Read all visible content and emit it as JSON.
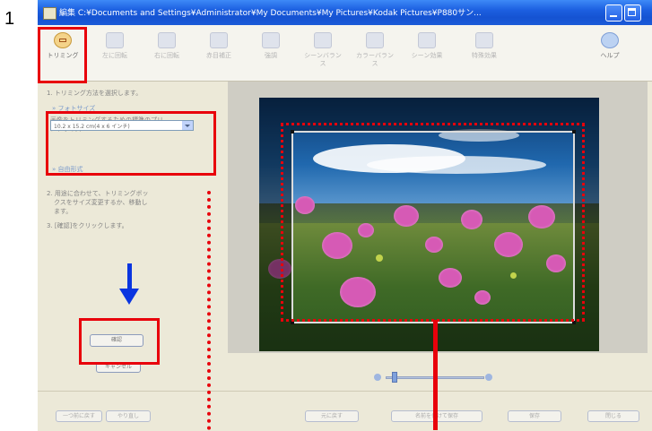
{
  "step_number": "1",
  "window": {
    "title": "編集 C:¥Documents and Settings¥Administrator¥My Documents¥My Pictures¥Kodak Pictures¥P880サン..."
  },
  "toolbar": {
    "items": [
      {
        "label": "トリミング",
        "icon": "trim-icon"
      },
      {
        "label": "左に回転",
        "icon": "rotate-left-icon"
      },
      {
        "label": "右に回転",
        "icon": "rotate-right-icon"
      },
      {
        "label": "赤目補正",
        "icon": "red-eye-icon"
      },
      {
        "label": "強調",
        "icon": "enhance-icon"
      },
      {
        "label": "シーンバランス",
        "icon": "scene-balance-icon"
      },
      {
        "label": "カラーバランス",
        "icon": "color-balance-icon"
      },
      {
        "label": "シーン効果",
        "icon": "scene-effect-icon"
      },
      {
        "label": "特殊効果",
        "icon": "special-effect-icon"
      },
      {
        "label": "ヘルプ",
        "icon": "help-icon"
      }
    ]
  },
  "left_panel": {
    "step1": "1. トリミング方法を選択します。",
    "photo_size_link": "» フォトサイズ",
    "size_desc_line1": "画像をトリミングするための標準のプリ",
    "size_desc_line2": "ントサイズ:",
    "size_select_value": "10.2 x 15.2 cm(4 x 6 インチ)",
    "free_form_link": "» 自由形式",
    "step2_line1": "2. 用途に合わせて、トリミングボッ",
    "step2_line2": "クスをサイズ変更するか、移動し",
    "step2_line3": "ます。",
    "step3": "3. [確認]をクリックします。",
    "confirm_button": "確認",
    "cancel_button": "キャンセル"
  },
  "footer": {
    "buttons": [
      "一つ前に戻す",
      "やり直し",
      "元に戻す",
      "名前を付けて保存",
      "保存",
      "閉じる"
    ]
  },
  "colors": {
    "highlight_red": "#e8000b",
    "arrow_blue": "#0a35e0",
    "titlebar_blue": "#1c5fe0"
  }
}
